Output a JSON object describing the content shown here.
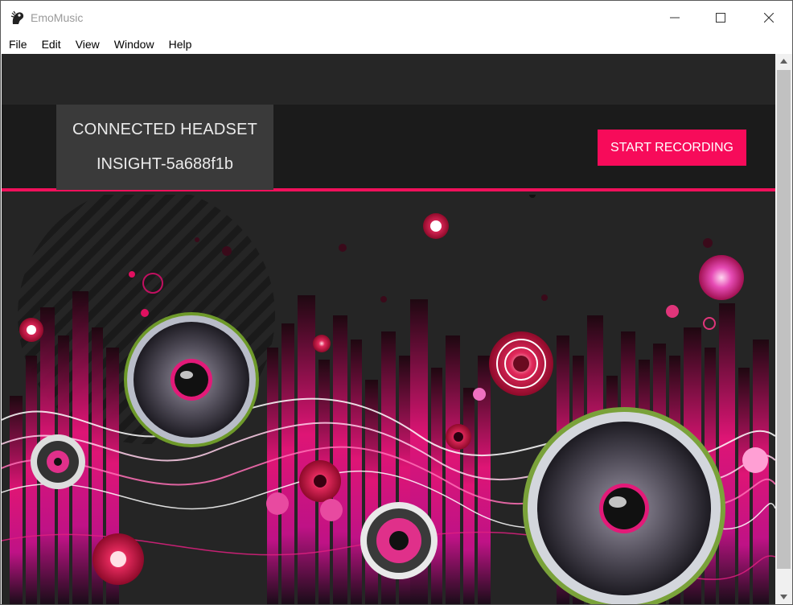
{
  "window": {
    "title": "EmoMusic",
    "icon": "emomusic-app-icon",
    "controls": {
      "minimize_icon": "minimize-icon",
      "maximize_icon": "maximize-icon",
      "close_icon": "close-icon"
    }
  },
  "menubar": {
    "items": [
      {
        "label": "File"
      },
      {
        "label": "Edit"
      },
      {
        "label": "View"
      },
      {
        "label": "Window"
      },
      {
        "label": "Help"
      }
    ]
  },
  "header": {
    "headset_title": "CONNECTED HEADSET",
    "headset_id": "INSIGHT-5a688f1b",
    "record_button_label": "START RECORDING"
  },
  "colors": {
    "accent": "#f70b5a",
    "header_bg": "#1b1b1b",
    "content_bg": "#252525",
    "headset_box_bg": "#3a3a3a"
  }
}
